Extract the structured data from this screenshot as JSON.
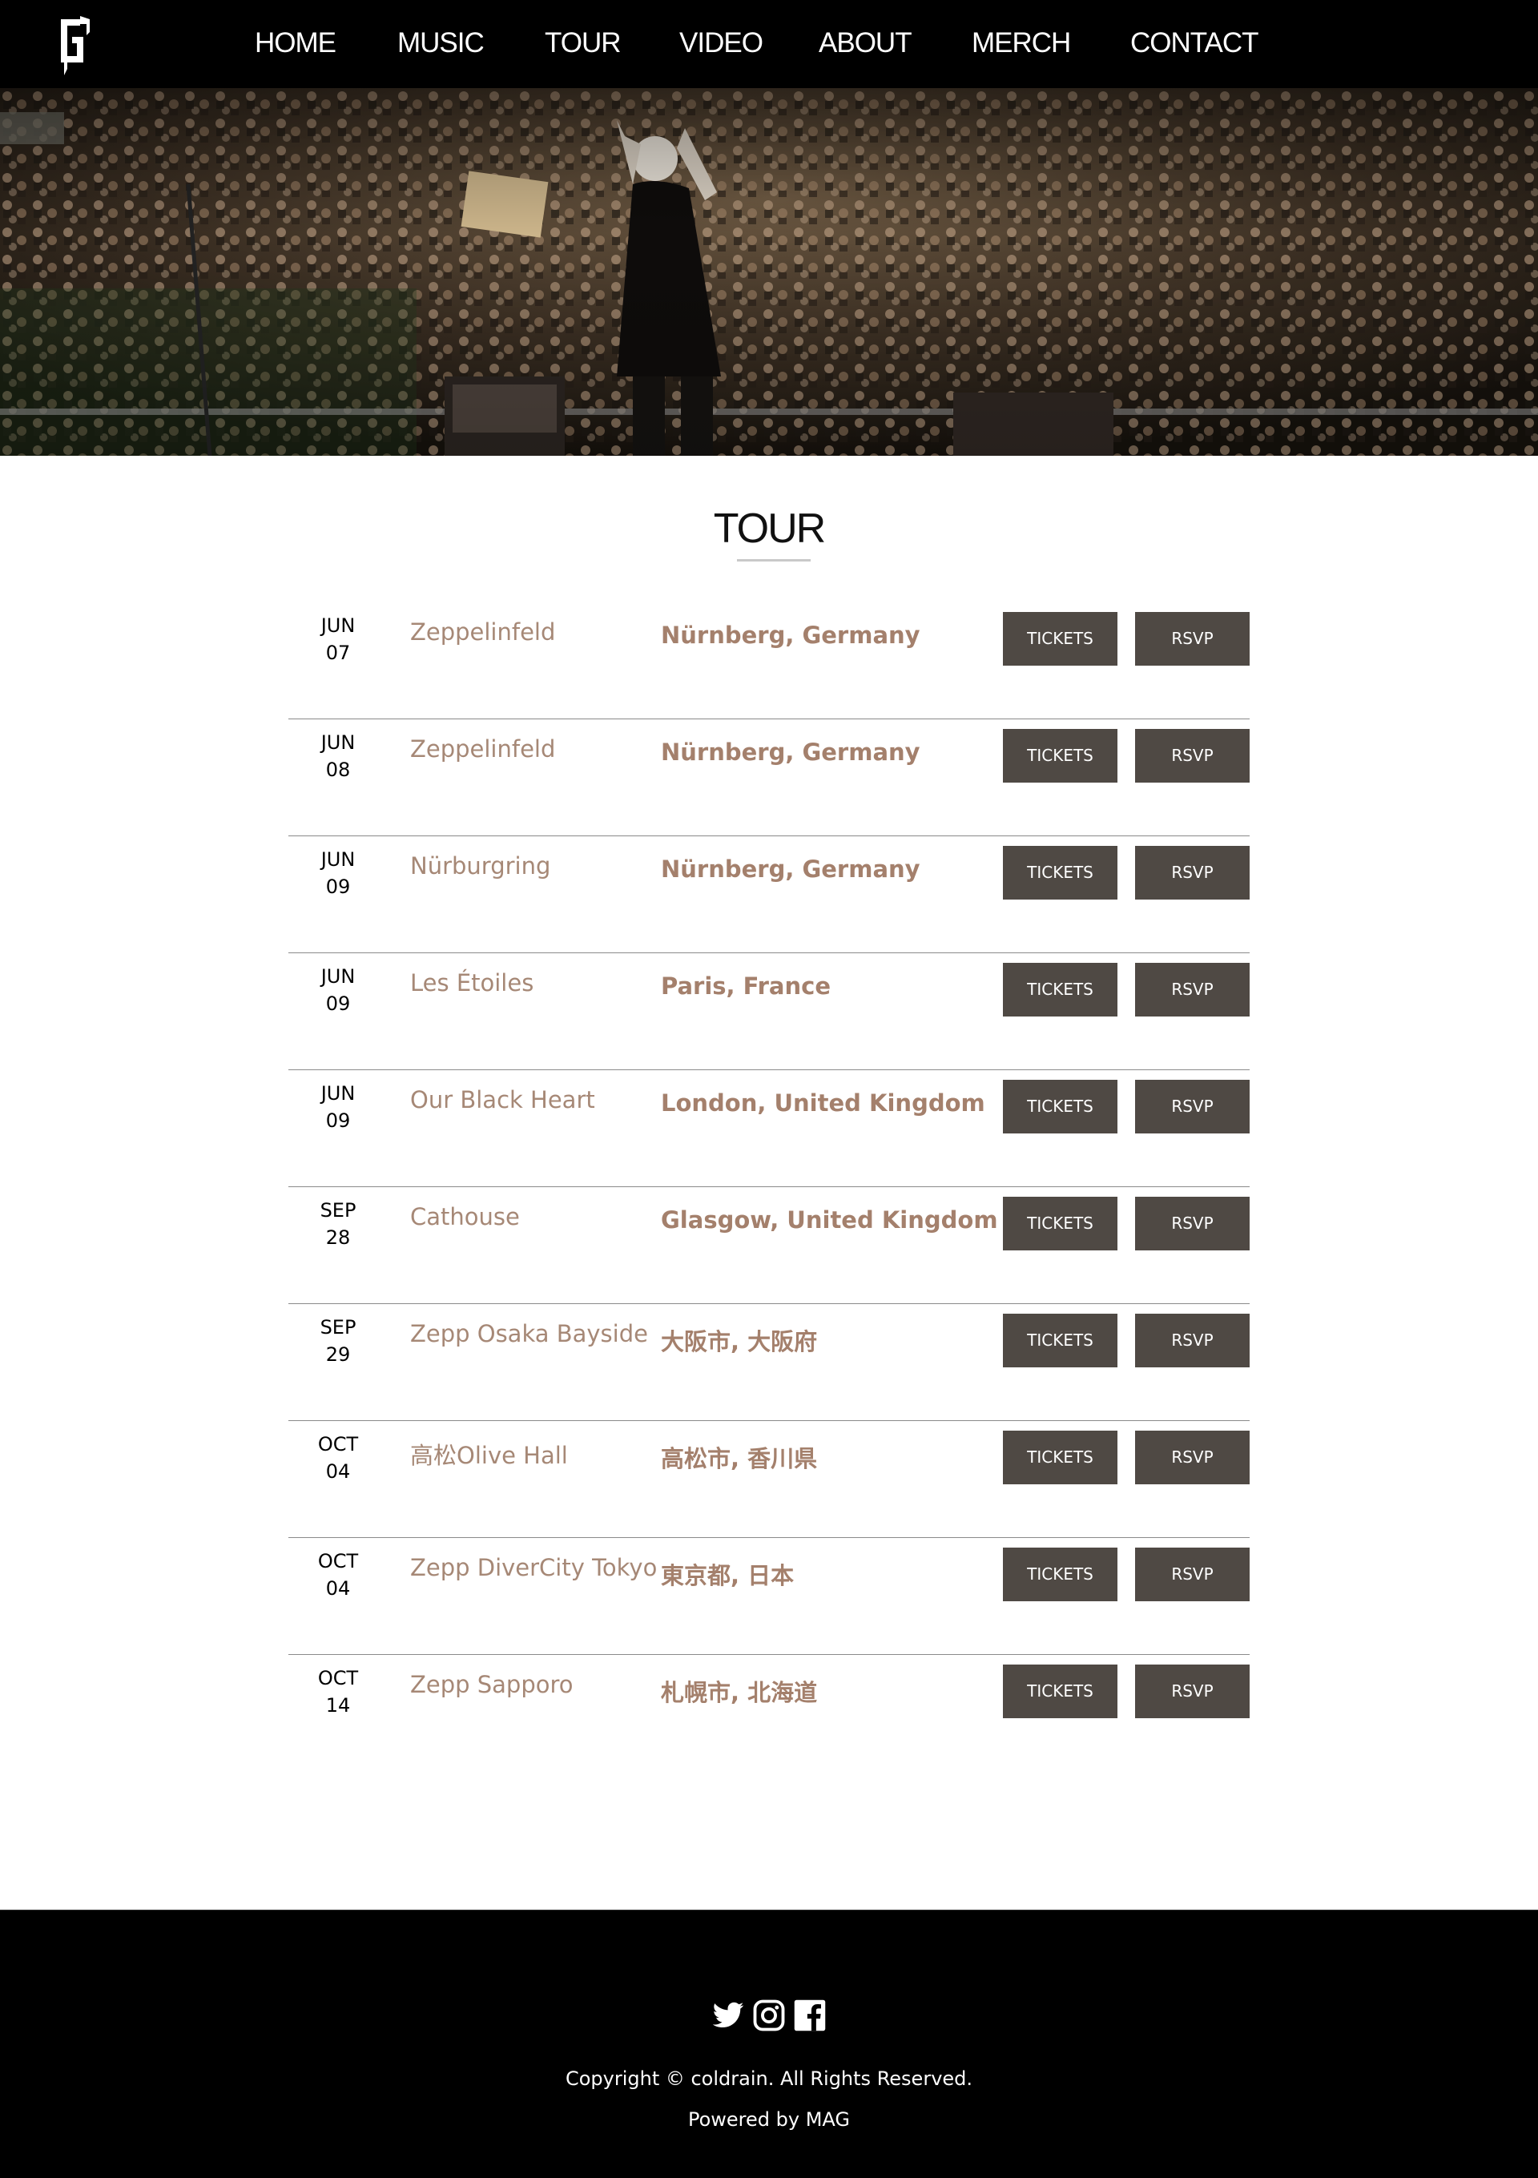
{
  "header": {
    "nav": [
      "HOME",
      "MUSIC",
      "TOUR",
      "VIDEO",
      "ABOUT",
      "MERCH",
      "CONTACT"
    ]
  },
  "tour": {
    "title": "TOUR",
    "button_tickets": "TICKETS",
    "button_rsvp": "RSVP",
    "dates": [
      {
        "month": "JUN",
        "day": "07",
        "venue": "Zeppelinfeld",
        "location": "Nürnberg, Germany"
      },
      {
        "month": "JUN",
        "day": "08",
        "venue": "Zeppelinfeld",
        "location": "Nürnberg, Germany"
      },
      {
        "month": "JUN",
        "day": "09",
        "venue": "Nürburgring",
        "location": "Nürnberg, Germany"
      },
      {
        "month": "JUN",
        "day": "09",
        "venue": "Les Étoiles",
        "location": "Paris, France"
      },
      {
        "month": "JUN",
        "day": "09",
        "venue": "Our Black Heart",
        "location": "London, United Kingdom"
      },
      {
        "month": "SEP",
        "day": "28",
        "venue": "Cathouse",
        "location": "Glasgow, United Kingdom"
      },
      {
        "month": "SEP",
        "day": "29",
        "venue": "Zepp Osaka Bayside",
        "location": "大阪市, 大阪府"
      },
      {
        "month": "OCT",
        "day": "04",
        "venue": "高松Olive Hall",
        "location": "高松市, 香川県"
      },
      {
        "month": "OCT",
        "day": "04",
        "venue": "Zepp DiverCity Tokyo",
        "location": "東京都, 日本"
      },
      {
        "month": "OCT",
        "day": "14",
        "venue": "Zepp Sapporo",
        "location": "札幌市, 北海道"
      }
    ]
  },
  "footer": {
    "social_icons": [
      "twitter-icon",
      "instagram-icon",
      "facebook-icon"
    ],
    "copyright": "Copyright © coldrain. All Rights Reserved.",
    "powered_by": "Powered by MAG"
  },
  "colors": {
    "header_bg": "#000000",
    "venue_text": "#a68876",
    "location_text": "#a4806c",
    "button_bg": "#4f4944",
    "footer_bg": "#000000"
  }
}
